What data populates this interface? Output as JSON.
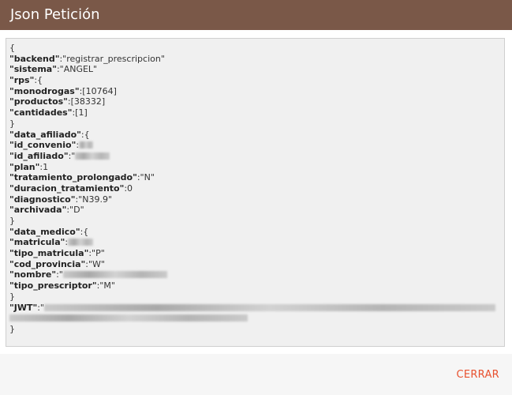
{
  "dialog": {
    "title": "Json Petición",
    "close_label": "CERRAR",
    "colors": {
      "header": "#7a5848",
      "close": "#e8512f",
      "box": "#f0f0f0"
    }
  },
  "json": {
    "open_brace": "{",
    "close_brace": "}",
    "backend_key": "\"backend\"",
    "backend_val": ":\"registrar_prescripcion\"",
    "sistema_key": "\"sistema\"",
    "sistema_val": ":\"ANGEL\"",
    "rps_key": "\"rps\"",
    "rps_val": ":{",
    "monodrogas_key": "\"monodrogas\"",
    "monodrogas_val": ":[10764]",
    "productos_key": "\"productos\"",
    "productos_val": ":[38332]",
    "cantidades_key": "\"cantidades\"",
    "cantidades_val": ":[1]",
    "rps_close": "}",
    "data_afiliado_key": "\"data_afiliado\"",
    "data_afiliado_val": ":{",
    "id_convenio_key": "\"id_convenio\"",
    "id_convenio_val": ":",
    "id_afiliado_key": "\"id_afiliado\"",
    "id_afiliado_val": ":\"",
    "plan_key": "\"plan\"",
    "plan_val": ":1",
    "tratamiento_key": "\"tratamiento_prolongado\"",
    "tratamiento_val": ":\"N\"",
    "duracion_key": "\"duracion_tratamiento\"",
    "duracion_val": ":0",
    "diagnostico_key": "\"diagnostico\"",
    "diagnostico_val": ":\"N39.9\"",
    "archivada_key": "\"archivada\"",
    "archivada_val": ":\"D\"",
    "afiliado_close": "}",
    "data_medico_key": "\"data_medico\"",
    "data_medico_val": ":{",
    "matricula_key": "\"matricula\"",
    "matricula_val": ":",
    "tipo_matricula_key": "\"tipo_matricula\"",
    "tipo_matricula_val": ":\"P\"",
    "cod_provincia_key": "\"cod_provincia\"",
    "cod_provincia_val": ":\"W\"",
    "nombre_key": "\"nombre\"",
    "nombre_val": ":\"",
    "tipo_prescriptor_key": "\"tipo_prescriptor\"",
    "tipo_prescriptor_val": ":\"M\"",
    "medico_close": "}",
    "jwt_key": "\"JWT\"",
    "jwt_val": ":\""
  }
}
